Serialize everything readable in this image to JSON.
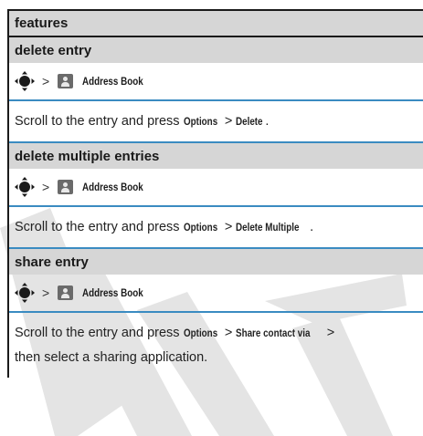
{
  "header": {
    "title": "features"
  },
  "sections": [
    {
      "title": "delete entry",
      "path": {
        "separator": ">",
        "app": "Address Book"
      },
      "desc": {
        "pre": "Scroll to the entry and press ",
        "k1": "Options",
        "sep": ">",
        "k2": "Delete",
        "post": "."
      }
    },
    {
      "title": "delete multiple entries",
      "path": {
        "separator": ">",
        "app": "Address Book"
      },
      "desc": {
        "pre": "Scroll to the entry and press ",
        "k1": "Options",
        "sep": ">",
        "k2": "Delete Multiple",
        "post": "."
      }
    },
    {
      "title": "share entry",
      "path": {
        "separator": ">",
        "app": "Address Book"
      },
      "desc": {
        "pre": "Scroll to the entry and press ",
        "k1": "Options",
        "sep": ">",
        "k2": "Share contact via",
        "sep2": ">",
        "post": "then select a sharing application."
      }
    }
  ],
  "watermark": {
    "text": "DRAFT",
    "color": "#e4e4e4"
  },
  "colors": {
    "rule": "#3a8bc1",
    "header_bg": "#d6d6d6"
  },
  "icons": [
    "nav-key-icon",
    "address-book-icon"
  ]
}
